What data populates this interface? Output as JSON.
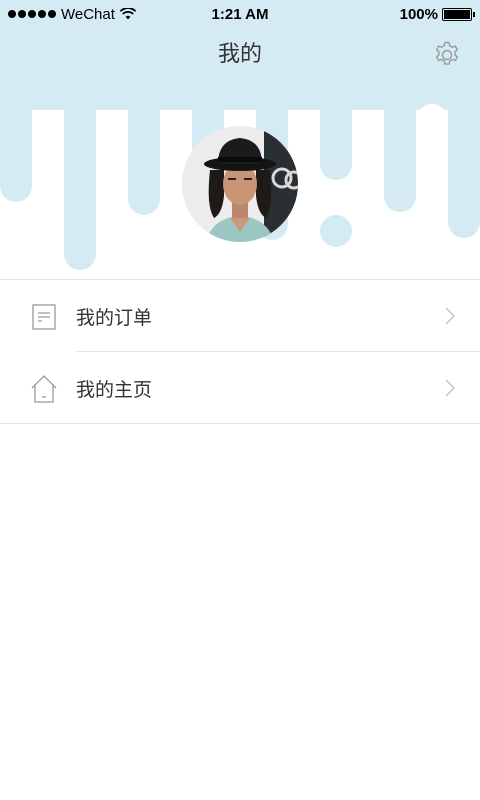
{
  "status_bar": {
    "carrier": "WeChat",
    "time": "1:21 AM",
    "battery": "100%",
    "battery_level": 1.0
  },
  "header": {
    "title": "我的"
  },
  "menu": {
    "items": [
      {
        "label": "我的订单",
        "icon": "order-document-icon"
      },
      {
        "label": "我的主页",
        "icon": "home-icon"
      }
    ]
  },
  "colors": {
    "drip": "#d5ebf3",
    "divider": "#e5e5e5",
    "icon_gray": "#9a9a9a",
    "chevron_gray": "#c4c4c4"
  }
}
